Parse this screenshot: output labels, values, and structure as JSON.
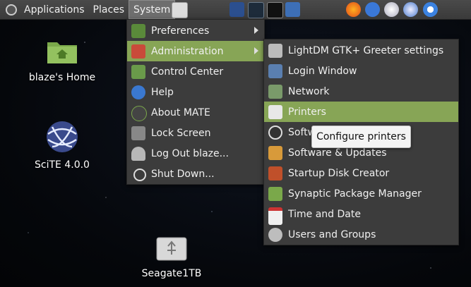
{
  "panel": {
    "applications_label": "Applications",
    "places_label": "Places",
    "system_label": "System"
  },
  "desktop": {
    "home_label": "blaze's Home",
    "scite_label": "SciTE 4.0.0",
    "drive_label": "Seagate1TB"
  },
  "system_menu": {
    "items": [
      {
        "label": "Preferences"
      },
      {
        "label": "Administration"
      },
      {
        "label": "Control Center"
      },
      {
        "label": "Help"
      },
      {
        "label": "About MATE"
      },
      {
        "label": "Lock Screen"
      },
      {
        "label": "Log Out blaze..."
      },
      {
        "label": "Shut Down..."
      }
    ]
  },
  "admin_menu": {
    "items": [
      {
        "label": "LightDM GTK+ Greeter settings"
      },
      {
        "label": "Login Window"
      },
      {
        "label": "Network"
      },
      {
        "label": "Printers"
      },
      {
        "label": "Software Properties"
      },
      {
        "label": "Software & Updates"
      },
      {
        "label": "Startup Disk Creator"
      },
      {
        "label": "Synaptic Package Manager"
      },
      {
        "label": "Time and Date"
      },
      {
        "label": "Users and Groups"
      }
    ]
  },
  "tooltip": {
    "text": "Configure printers"
  },
  "colors": {
    "highlight": "#87a556",
    "menu_bg": "#3c3c3c",
    "panel_bg": "#424242"
  }
}
